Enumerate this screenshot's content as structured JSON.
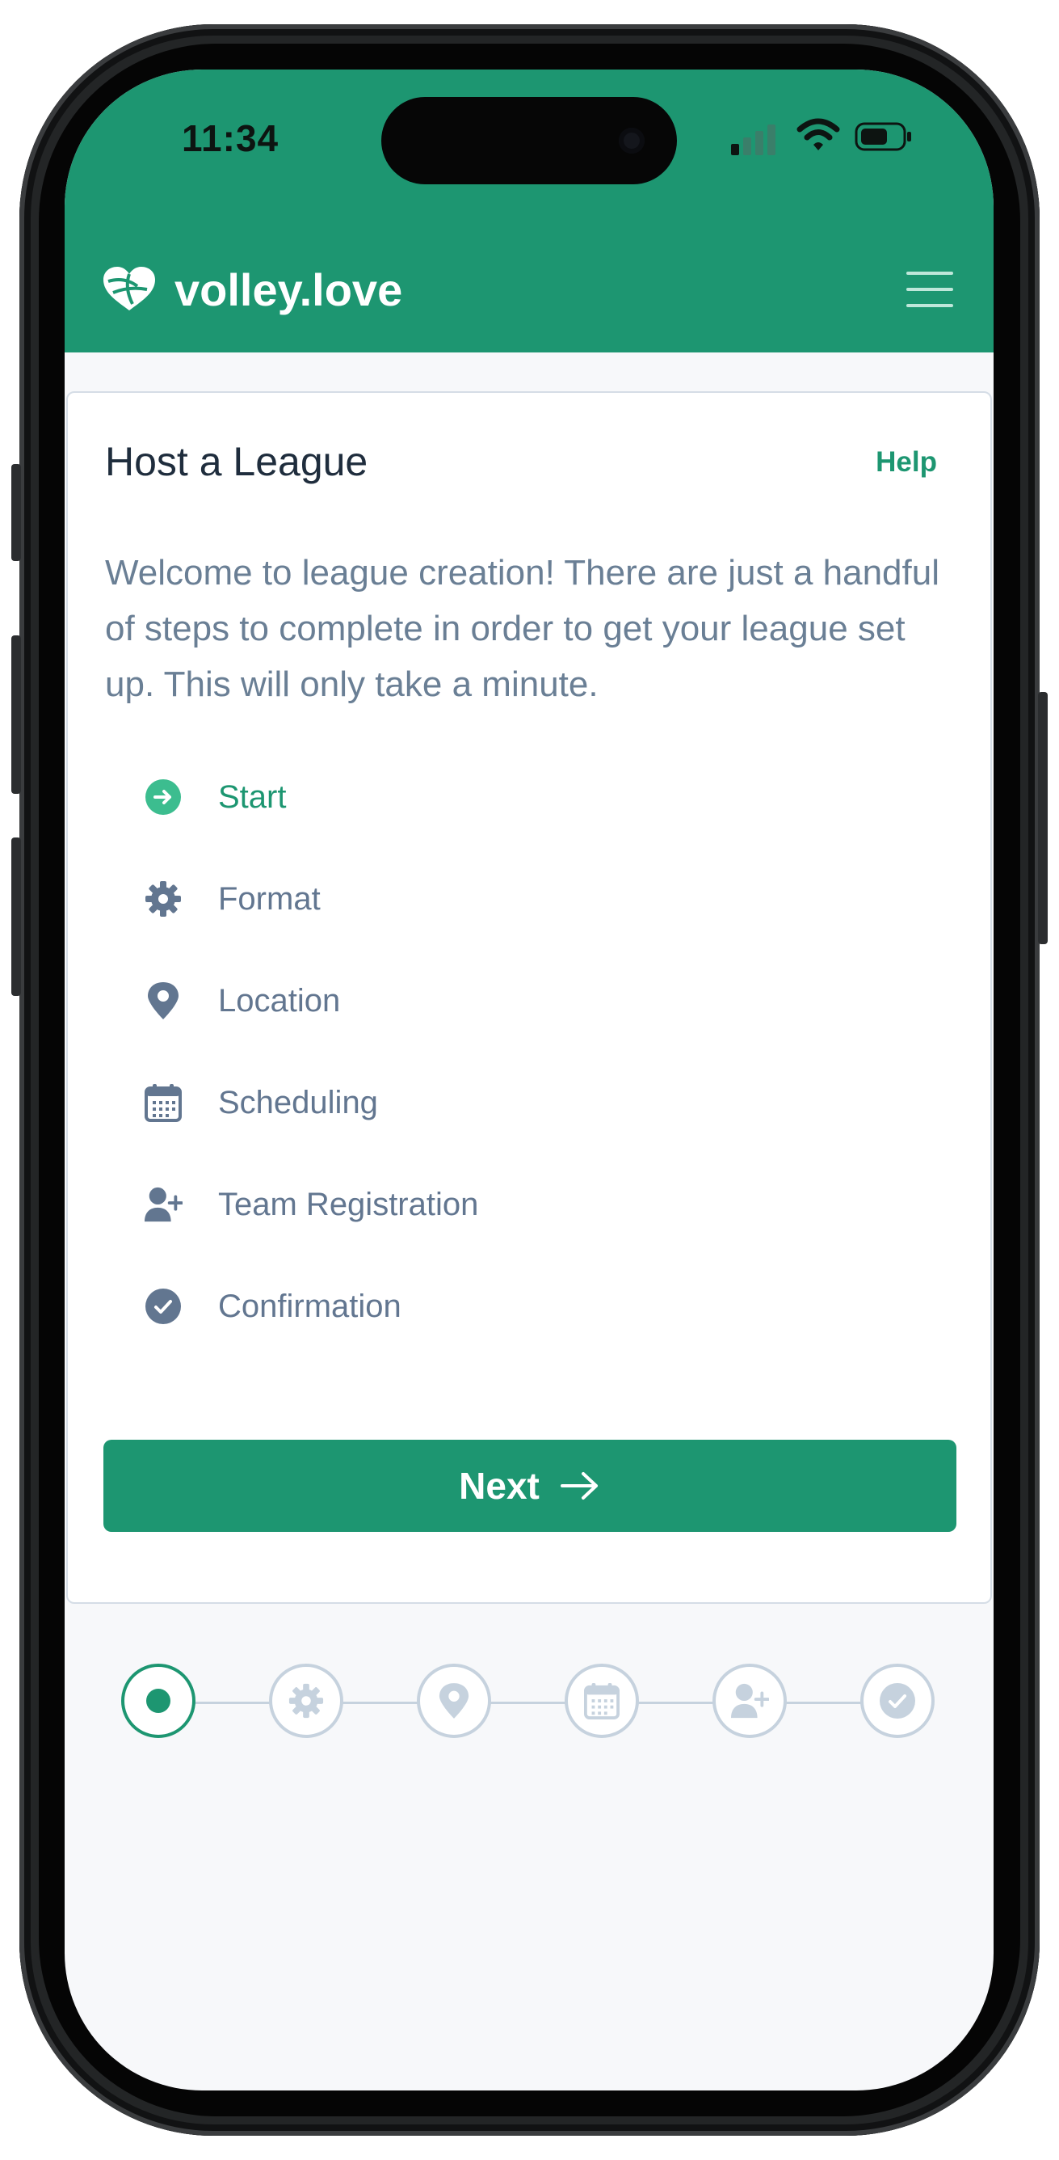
{
  "status_bar": {
    "time": "11:34"
  },
  "app_bar": {
    "brand": "volley.love",
    "logo_icon": "volleyball-heart-icon",
    "menu_icon": "hamburger-menu-icon"
  },
  "card": {
    "title": "Host a League",
    "help_label": "Help",
    "intro": "Welcome to league creation! There are just a handful of steps to complete in order to get your league set up. This will only take a minute.",
    "steps": [
      {
        "label": "Start",
        "icon": "arrow-right-circle-icon",
        "active": true
      },
      {
        "label": "Format",
        "icon": "gear-icon",
        "active": false
      },
      {
        "label": "Location",
        "icon": "map-pin-icon",
        "active": false
      },
      {
        "label": "Scheduling",
        "icon": "calendar-icon",
        "active": false
      },
      {
        "label": "Team Registration",
        "icon": "user-plus-icon",
        "active": false
      },
      {
        "label": "Confirmation",
        "icon": "check-circle-icon",
        "active": false
      }
    ],
    "next_label": "Next"
  },
  "progress": {
    "current_step": 1,
    "total_steps": 6
  },
  "colors": {
    "brand_green": "#1d9671",
    "muted_slate": "#627690",
    "light_border": "#c6d2de",
    "background": "#f7f8fa"
  }
}
